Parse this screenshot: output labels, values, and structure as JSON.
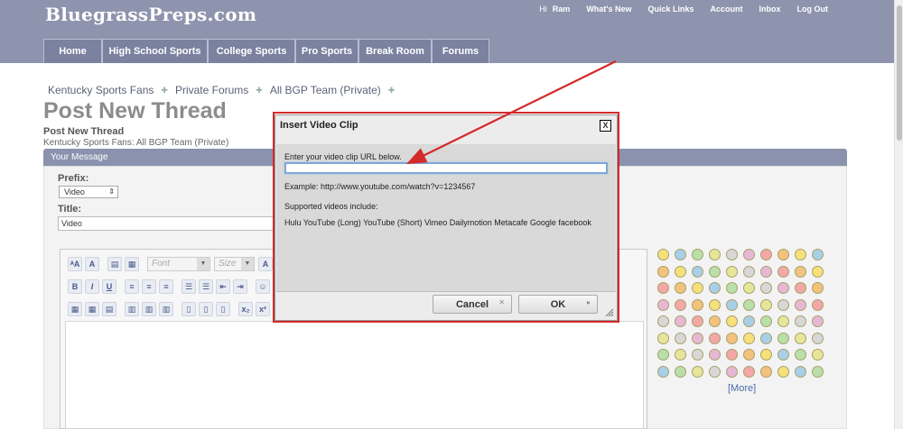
{
  "header": {
    "logo": "BluegrassPreps.com",
    "greeting": "Hi",
    "username": "Ram",
    "links": [
      "What's New",
      "Quick Links",
      "Account",
      "Inbox",
      "Log Out"
    ],
    "tabs": [
      "Home",
      "High School Sports",
      "College Sports",
      "Pro Sports",
      "Break Room",
      "Forums"
    ]
  },
  "breadcrumb": [
    "Kentucky Sports Fans",
    "Private Forums",
    "All BGP Team (Private)"
  ],
  "page": {
    "title": "Post New Thread",
    "subtitle": "Post New Thread",
    "subtitle_desc": "Kentucky Sports Fans: All BGP Team (Private)",
    "message_bar": "Your Message",
    "prefix_label": "Prefix:",
    "prefix_value": "Video",
    "title_label": "Title:",
    "title_value": "Video"
  },
  "editor": {
    "font_placeholder": "Font",
    "size_placeholder": "Size",
    "bold": "B",
    "italic": "I",
    "underline": "U"
  },
  "smilies": {
    "more_label": "[More]"
  },
  "dialog": {
    "title": "Insert Video Clip",
    "close_label": "X",
    "url_label": "Enter your video clip URL below.",
    "url_value": "",
    "example": "Example: http://www.youtube.com/watch?v=1234567",
    "supported_label": "Supported videos include:",
    "providers": "Hulu YouTube (Long) YouTube (Short) Vimeo Dailymotion Metacafe Google facebook",
    "cancel_label": "Cancel",
    "ok_label": "OK"
  },
  "colors": {
    "header_bg": "#8e94ad",
    "annotation_red": "#d42a2a",
    "input_focus": "#7ea7d8"
  }
}
